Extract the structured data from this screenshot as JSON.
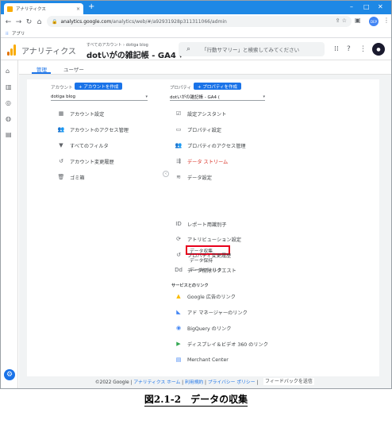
{
  "browser": {
    "tab_title": "アナリティクス",
    "tab_close": "×",
    "new_tab": "+",
    "url_host": "analytics.google.com",
    "url_path": "/analytics/web/#/a92931928p311311066/admin",
    "bookmark_apps_label": "アプリ",
    "profile_initials": "DEP"
  },
  "header": {
    "product_title": "アナリティクス",
    "account_crumb": "すべてのアカウント › dotiga blog",
    "property_name": "dotいがの雑記帳 - GA4",
    "search_placeholder": "「行動サマリー」と検索してみてください"
  },
  "subtabs": {
    "admin": "管理",
    "user": "ユーザー"
  },
  "account_column": {
    "label": "アカウント",
    "create_button": "+ アカウントを作成",
    "selected": "dotiga blog",
    "items": [
      {
        "icon": "building-icon",
        "glyph": "▦",
        "label": "アカウント設定"
      },
      {
        "icon": "people-icon",
        "glyph": "👥",
        "label": "アカウントのアクセス管理"
      },
      {
        "icon": "filter-icon",
        "glyph": "▼",
        "label": "すべてのフィルタ"
      },
      {
        "icon": "history-icon",
        "glyph": "↺",
        "label": "アカウント変更履歴"
      },
      {
        "icon": "trash-icon",
        "glyph": "🗑",
        "label": "ゴミ箱"
      }
    ]
  },
  "property_column": {
    "label": "プロパティ",
    "create_button": "+ プロパティを作成",
    "selected": "dotいがの雑記帳 - GA4 (",
    "items": [
      {
        "icon": "checklist-icon",
        "glyph": "☑",
        "label": "設定アシスタント"
      },
      {
        "icon": "property-icon",
        "glyph": "▭",
        "label": "プロパティ設定"
      },
      {
        "icon": "people-icon",
        "glyph": "👥",
        "label": "プロパティのアクセス管理"
      },
      {
        "icon": "data-streams-icon",
        "glyph": "⇶",
        "label": "データ ストリーム"
      },
      {
        "icon": "database-icon",
        "glyph": "≋",
        "label": "データ設定"
      }
    ],
    "data_settings_sub": [
      "データ収集",
      "データ保持",
      "データフィルタ"
    ],
    "items2": [
      {
        "icon": "id-icon",
        "glyph": "ⅠD",
        "label": "レポート用識別子"
      },
      {
        "icon": "attribution-icon",
        "glyph": "⟳",
        "label": "アトリビューション設定"
      },
      {
        "icon": "history-icon",
        "glyph": "↺",
        "label": "プロパティ変更履歴"
      },
      {
        "icon": "dd-icon",
        "glyph": "Dd",
        "label": "データ削除リクエスト"
      }
    ],
    "links_section": "サービスとのリンク",
    "links": [
      {
        "icon": "google-ads-icon",
        "glyph": "▲",
        "color": "#fbbc04",
        "label": "Google 広告のリンク"
      },
      {
        "icon": "ad-manager-icon",
        "glyph": "◣",
        "color": "#4285f4",
        "label": "アド マネージャーのリンク"
      },
      {
        "icon": "bigquery-icon",
        "glyph": "◉",
        "color": "#4285f4",
        "label": "BigQuery のリンク"
      },
      {
        "icon": "display-video-icon",
        "glyph": "▶",
        "color": "#34a853",
        "label": "ディスプレイ＆ビデオ 360 のリンク"
      },
      {
        "icon": "merchant-center-icon",
        "glyph": "▤",
        "color": "#4285f4",
        "label": "Merchant Center"
      }
    ]
  },
  "footer": {
    "copyright": "©2022 Google",
    "home": "アナリティクス ホーム",
    "terms": "利用規約",
    "privacy": "プライバシー ポリシー",
    "feedback": "フィードバックを送信"
  },
  "caption": "図2.1-2　データの収集",
  "colors": {
    "accent": "#1a73e8",
    "highlight": "#e8001c",
    "active_item": "#d93025"
  }
}
